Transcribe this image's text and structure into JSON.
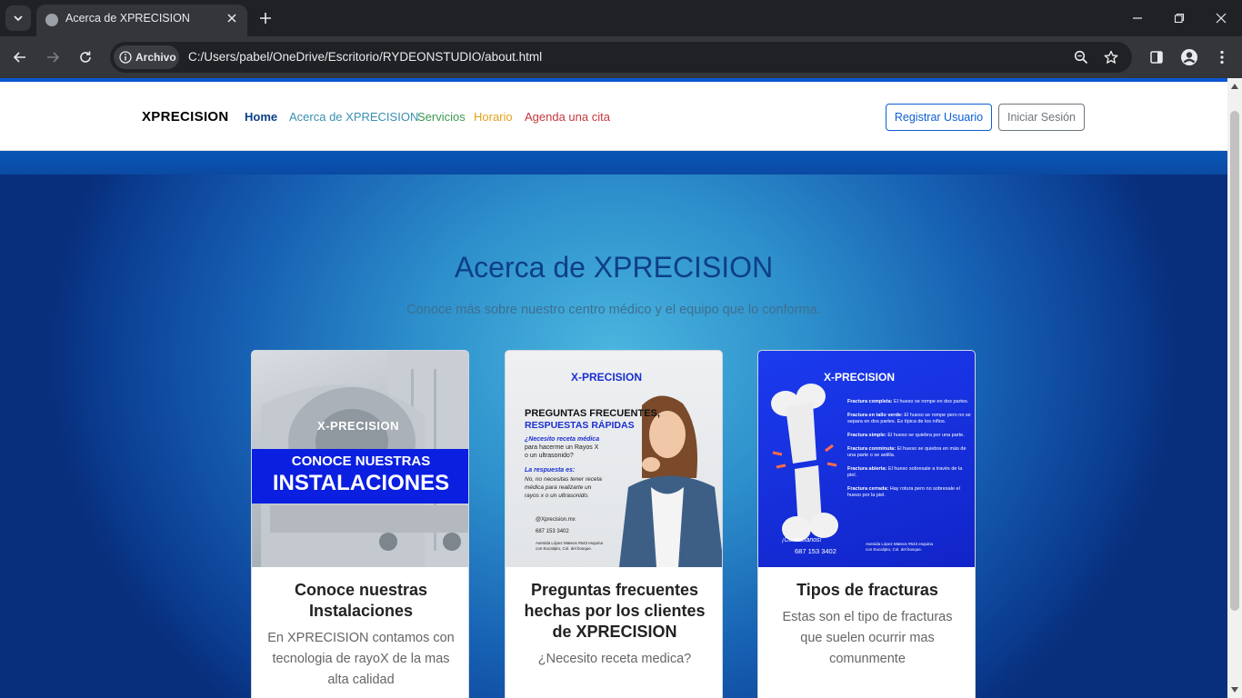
{
  "browser": {
    "tab_title": "Acerca de XPRECISION",
    "site_chip": "Archivo",
    "url": "C:/Users/pabel/OneDrive/Escritorio/RYDEONSTUDIO/about.html"
  },
  "navbar": {
    "brand": "XPRECISION",
    "links": [
      {
        "label": "Home",
        "color": "#0d3f86"
      },
      {
        "label": "Acerca de XPRECISION",
        "color": "#3a8fb0"
      },
      {
        "label": "Servicios",
        "color": "#3c9a52"
      },
      {
        "label": "Horario",
        "color": "#e5a11c"
      },
      {
        "label": "Agenda una cita",
        "color": "#c8373f"
      }
    ],
    "register_label": "Registrar Usuario",
    "login_label": "Iniciar Sesión"
  },
  "hero": {
    "title": "Acerca de XPRECISION",
    "subtitle": "Conoce más sobre nuestro centro médico y el equipo que lo conforma."
  },
  "cards": [
    {
      "title": "Conoce nuestras Instalaciones",
      "text": "En XPRECISION contamos con tecnologia de rayoX de la mas alta calidad",
      "image": {
        "brand": "X-PRECISION",
        "line1": "CONOCE NUESTRAS",
        "line2": "INSTALACIONES"
      }
    },
    {
      "title": "Preguntas frecuentes hechas por los clientes de XPRECISION",
      "text": "¿Necesito receta medica?",
      "image": {
        "brand": "X-PRECISION",
        "heading1": "PREGUNTAS FRECUENTES,",
        "heading2": "RESPUESTAS RÁPIDAS",
        "q1": "¿Necesito receta médica",
        "q2": "para hacerme un Rayos X",
        "q3": "o un ultrasonido?",
        "a_label": "La respuesta es:",
        "a1": "No, no necesitas tener receta",
        "a2": "médica para realizarte un",
        "a3": "rayos x o un ultrasonido.",
        "social": "@Xprecision.mx",
        "phone": "687 153 3402",
        "address1": "Avenida López Mateos #643 esquina",
        "address2": "con Eucalipto, Col. del bosque."
      }
    },
    {
      "title": "Tipos de fracturas",
      "text": "Estas son el tipo de fracturas que suelen ocurrir mas comunmente",
      "image": {
        "brand": "X-PRECISION",
        "items": [
          {
            "head": "Fractura completa:",
            "desc": "El hueso se rompe en dos partes."
          },
          {
            "head": "Fractura en tallo verde:",
            "desc": "El hueso se rompe pero no se separa en dos partes. Es típica de los niños."
          },
          {
            "head": "Fractura simple:",
            "desc": "El hueso se quiebra por una parte."
          },
          {
            "head": "Fractura conminuta:",
            "desc": "El hueso se quiebra en más de una parte o se astilla."
          },
          {
            "head": "Fractura abierta:",
            "desc": "El hueso sobresale a través de la piel."
          },
          {
            "head": "Fractura cerrada:",
            "desc": "Hay rotura pero no sobresale el hueso por la piel."
          }
        ],
        "contact": "¡Contactanos!",
        "phone": "687 153 3402",
        "address1": "Avenida López Mateos #643 esquina",
        "address2": "con Eucalipto, Col. del bosque."
      }
    }
  ],
  "colors": {
    "accent": "#0d3f86",
    "register_border": "#0b5ed7",
    "login_border": "#6c757d"
  }
}
